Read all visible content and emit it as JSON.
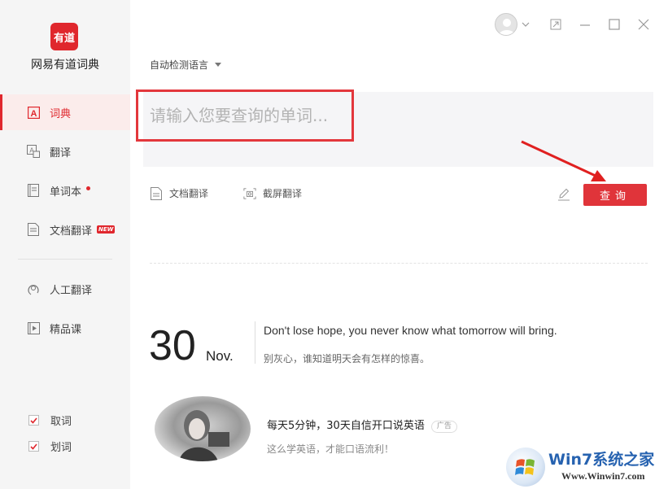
{
  "app": {
    "logo_text": "有道",
    "name": "网易有道词典"
  },
  "sidebar": {
    "items": [
      {
        "label": "词典",
        "icon": "dictionary-icon",
        "active": true
      },
      {
        "label": "翻译",
        "icon": "translate-icon"
      },
      {
        "label": "单词本",
        "icon": "wordbook-icon",
        "dot": true
      },
      {
        "label": "文档翻译",
        "icon": "document-icon",
        "badge": "NEW"
      },
      {
        "label": "人工翻译",
        "icon": "human-translate-icon"
      },
      {
        "label": "精品课",
        "icon": "course-icon"
      }
    ],
    "checks": [
      {
        "label": "取词",
        "checked": true
      },
      {
        "label": "划词",
        "checked": true
      }
    ]
  },
  "main": {
    "lang_select": "自动检测语言",
    "search_placeholder": "请输入您要查询的单词...",
    "tools": {
      "doc_translate": "文档翻译",
      "screenshot_translate": "截屏翻译"
    },
    "search_button": "查询"
  },
  "daily": {
    "day": "30",
    "month": "Nov.",
    "quote_en": "Don't lose hope, you never know what tomorrow will bring.",
    "quote_cn": "别灰心，谁知道明天会有怎样的惊喜。"
  },
  "ad": {
    "title": "每天5分钟，30天自信开口说英语",
    "badge": "广告",
    "subtitle": "这么学英语，才能口语流利！"
  },
  "watermark": {
    "title": "Win7系统之家",
    "url": "Www.Winwin7.com"
  },
  "colors": {
    "accent": "#e0272d",
    "highlight_border": "#e3373c",
    "sidebar_bg": "#f5f5f5",
    "input_bg": "#f5f5f7"
  }
}
